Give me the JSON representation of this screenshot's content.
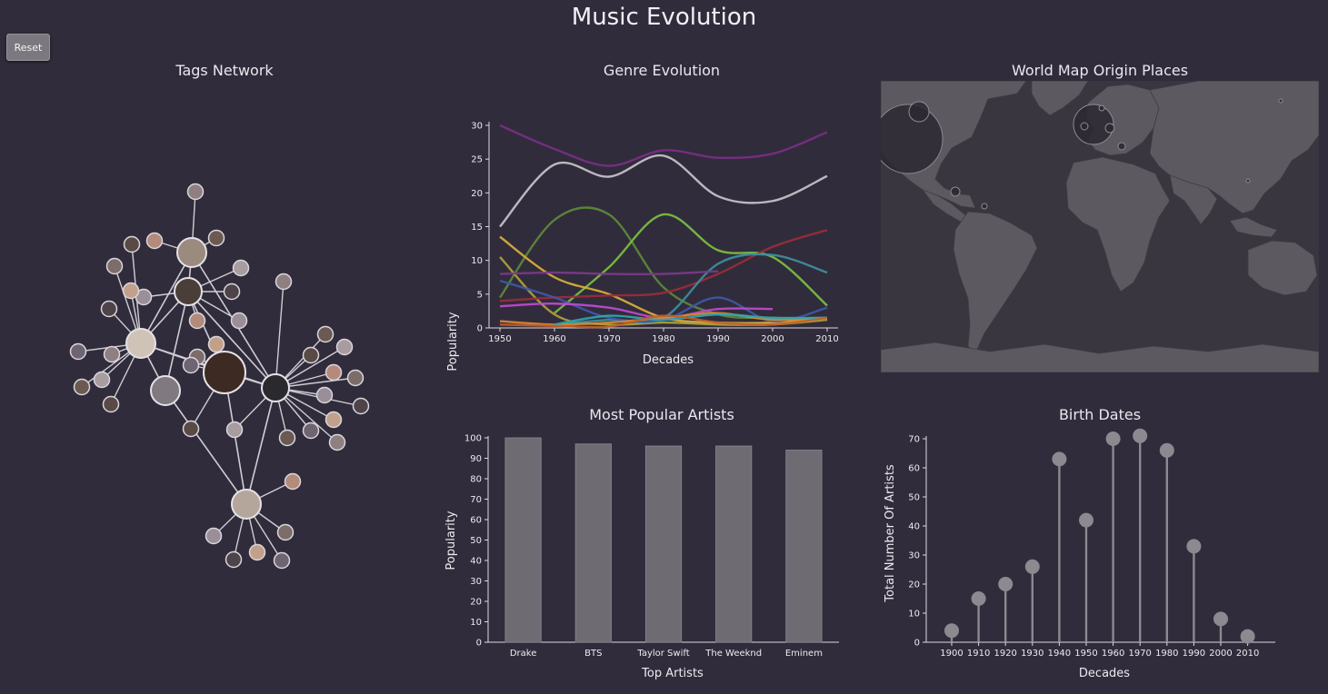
{
  "header": {
    "title": "Music Evolution",
    "reset_label": "Reset"
  },
  "panels": {
    "network_title": "Tags Network",
    "genre_title": "Genre Evolution",
    "map_title": "World Map Origin Places",
    "artists_title": "Most Popular Artists",
    "birth_title": "Birth Dates"
  },
  "colors": {
    "background": "#312c3b",
    "bar": "#6f6b73",
    "lollipop": "#8c8990",
    "land": "#5c5a60",
    "ocean": "#3a3640"
  },
  "chart_data": [
    {
      "id": "genre",
      "type": "line",
      "title": "Genre Evolution",
      "xlabel": "Decades",
      "ylabel": "Popularity",
      "x": [
        1950,
        1960,
        1970,
        1980,
        1990,
        2000,
        2010
      ],
      "ylim": [
        0,
        30
      ],
      "yticks": [
        0,
        5,
        10,
        15,
        20,
        25,
        30
      ],
      "series": [
        {
          "color": "#7a2f86",
          "values": [
            30,
            26.5,
            24,
            26.3,
            25.2,
            25.8,
            29
          ]
        },
        {
          "color": "#c8c4cc",
          "values": [
            15,
            24.2,
            22.4,
            25.5,
            19.5,
            18.8,
            22.5
          ]
        },
        {
          "color": "#5b8a3a",
          "values": [
            4.5,
            16,
            16.8,
            6,
            2,
            1.5,
            1.5
          ]
        },
        {
          "color": "#7cc043",
          "values": [
            null,
            2.2,
            9,
            16.8,
            11.5,
            10.5,
            3.3
          ]
        },
        {
          "color": "#d9b03b",
          "values": [
            13.5,
            7.5,
            5,
            1.5,
            0.8,
            0.8,
            1.5
          ]
        },
        {
          "color": "#b0a23c",
          "values": [
            10.5,
            2,
            0.5,
            0.8,
            0.5,
            0.5,
            1.2
          ]
        },
        {
          "color": "#9a2c3c",
          "values": [
            4,
            4.5,
            4.8,
            5.2,
            8,
            12,
            14.5
          ]
        },
        {
          "color": "#3d8fa0",
          "values": [
            null,
            0.5,
            1.2,
            1.5,
            9.5,
            10.8,
            8.2
          ]
        },
        {
          "color": "#7b3a8c",
          "values": [
            8,
            8.2,
            8,
            8,
            8.4,
            null,
            null
          ]
        },
        {
          "color": "#3f58a8",
          "values": [
            7,
            4.5,
            1.5,
            1.2,
            4.5,
            1,
            3
          ]
        },
        {
          "color": "#c04ad0",
          "values": [
            3.2,
            3.6,
            3,
            1.5,
            2.8,
            2.8,
            null
          ]
        },
        {
          "color": "#d88a33",
          "values": [
            1,
            0.5,
            0.8,
            1.5,
            2.2,
            1.2,
            1.5
          ]
        },
        {
          "color": "#2fa6b0",
          "values": [
            null,
            0.5,
            1.8,
            1.2,
            2,
            1.5,
            1.5
          ]
        },
        {
          "color": "#c0602a",
          "values": [
            0.5,
            0.3,
            0.2,
            1.8,
            0.8,
            0.5,
            1.5
          ]
        }
      ]
    },
    {
      "id": "artists",
      "type": "bar",
      "title": "Most Popular Artists",
      "xlabel": "Top Artists",
      "ylabel": "Popularity",
      "categories": [
        "Drake",
        "BTS",
        "Taylor Swift",
        "The Weeknd",
        "Eminem"
      ],
      "values": [
        100,
        97,
        96,
        96,
        94
      ],
      "ylim": [
        0,
        100
      ],
      "yticks": [
        0,
        10,
        20,
        30,
        40,
        50,
        60,
        70,
        80,
        90,
        100
      ]
    },
    {
      "id": "birth",
      "type": "lollipop",
      "title": "Birth Dates",
      "xlabel": "Decades",
      "ylabel": "Total Number Of Artists",
      "categories": [
        "1900",
        "1910",
        "1920",
        "1930",
        "1940",
        "1950",
        "1960",
        "1970",
        "1980",
        "1990",
        "2000",
        "2010"
      ],
      "values": [
        4,
        15,
        20,
        26,
        63,
        42,
        70,
        71,
        66,
        33,
        8,
        2
      ],
      "ylim": [
        0,
        70
      ],
      "yticks": [
        0,
        10,
        20,
        30,
        40,
        50,
        60,
        70
      ]
    }
  ]
}
